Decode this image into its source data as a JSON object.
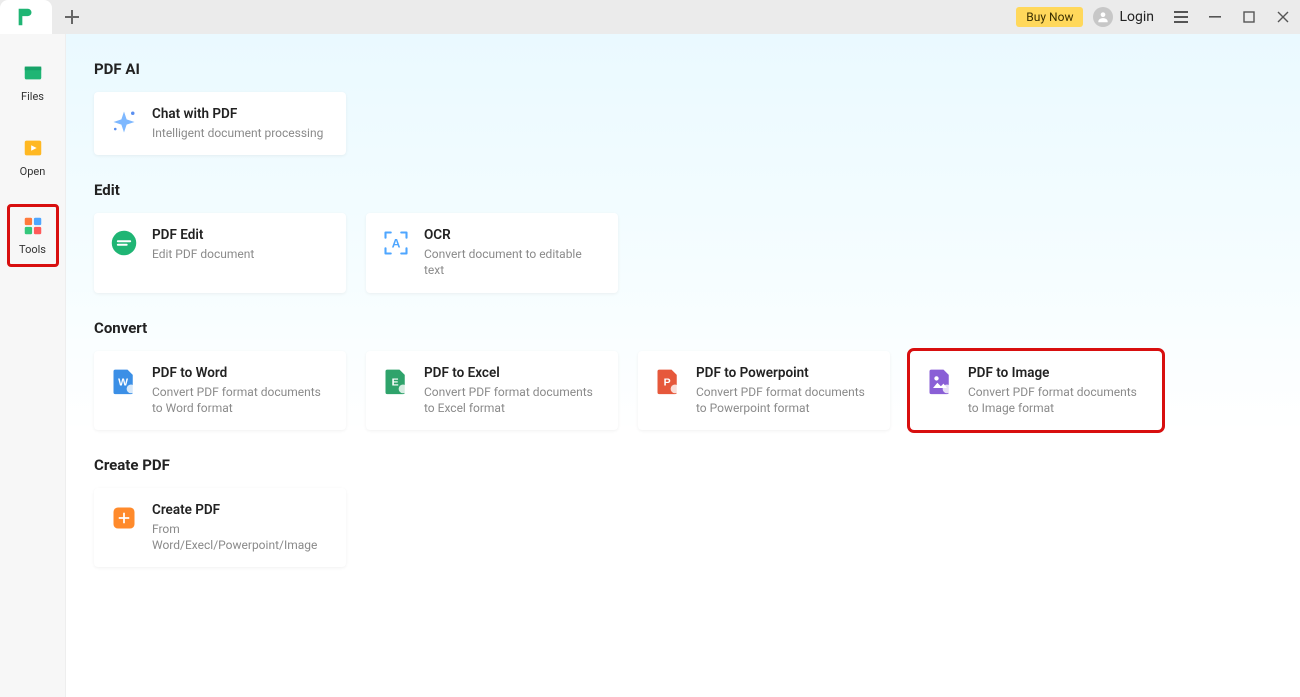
{
  "titlebar": {
    "buy_now": "Buy Now",
    "login": "Login"
  },
  "sidebar": {
    "items": [
      {
        "label": "Files"
      },
      {
        "label": "Open"
      },
      {
        "label": "Tools"
      }
    ]
  },
  "sections": {
    "pdfai": {
      "title": "PDF AI",
      "cards": [
        {
          "title": "Chat with PDF",
          "desc": "Intelligent document processing"
        }
      ]
    },
    "edit": {
      "title": "Edit",
      "cards": [
        {
          "title": "PDF Edit",
          "desc": "Edit PDF document"
        },
        {
          "title": "OCR",
          "desc": "Convert document to editable text"
        }
      ]
    },
    "convert": {
      "title": "Convert",
      "cards": [
        {
          "title": "PDF to Word",
          "desc": "Convert PDF format documents to Word format"
        },
        {
          "title": "PDF to Excel",
          "desc": "Convert PDF format documents to Excel format"
        },
        {
          "title": "PDF to Powerpoint",
          "desc": "Convert PDF format documents to Powerpoint format"
        },
        {
          "title": "PDF to Image",
          "desc": "Convert PDF format documents to Image format"
        }
      ]
    },
    "create": {
      "title": "Create PDF",
      "cards": [
        {
          "title": "Create PDF",
          "desc": "From Word/Execl/Powerpoint/Image"
        }
      ]
    }
  }
}
